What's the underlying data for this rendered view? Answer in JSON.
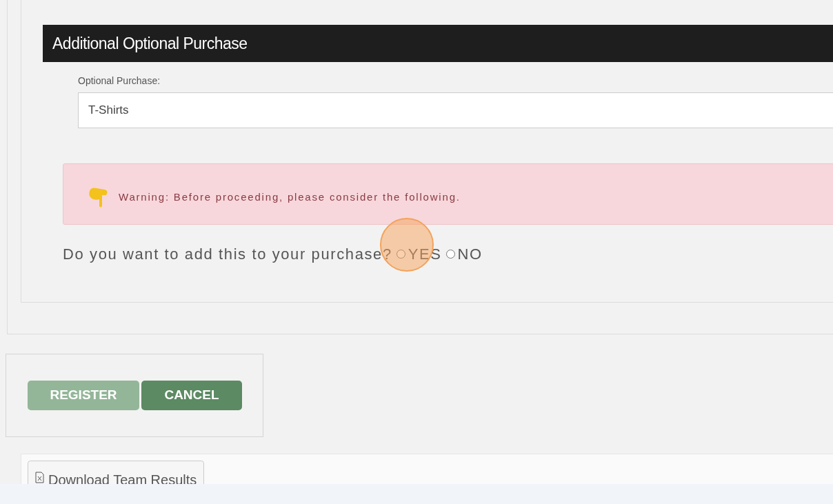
{
  "section": {
    "title": "Additional Optional Purchase"
  },
  "field": {
    "label": "Optional Purchase:",
    "value": "T-Shirts"
  },
  "alert": {
    "text": "Warning: Before proceeding, please consider the following."
  },
  "question": {
    "text": "Do you want to add this to your purchase?",
    "options": [
      {
        "label": "YES",
        "selected": false
      },
      {
        "label": "NO",
        "selected": false
      }
    ]
  },
  "buttons": [
    {
      "label": "REGISTER",
      "disabled": true
    },
    {
      "label": "CANCEL",
      "disabled": false
    }
  ],
  "download": {
    "label": "Download Team Results"
  },
  "click_highlight": true
}
